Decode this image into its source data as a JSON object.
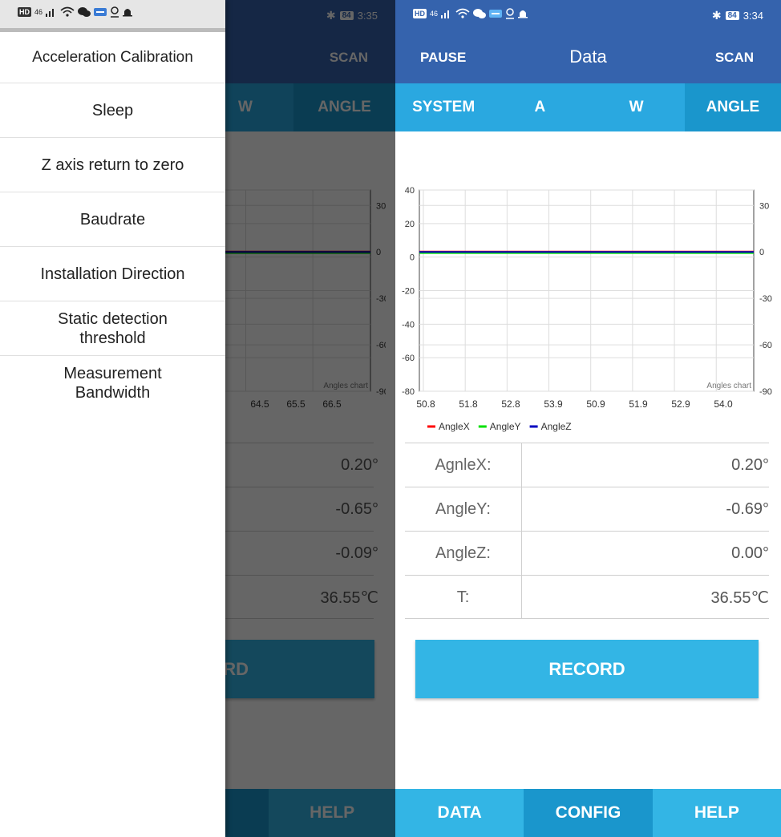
{
  "status_left": {
    "hd_badge": "HD",
    "network": "46",
    "time": "3:35",
    "battery": "84"
  },
  "status_right": {
    "hd_badge": "HD",
    "network": "46",
    "time": "3:34",
    "battery": "84"
  },
  "toolbar": {
    "pause_label": "PAUSE",
    "title": "Data",
    "scan_label": "SCAN"
  },
  "tabs": [
    {
      "label": "SYSTEM",
      "selected": false
    },
    {
      "label": "A",
      "selected": false
    },
    {
      "label": "W",
      "selected": false
    },
    {
      "label": "ANGLE",
      "selected": true
    }
  ],
  "chart_data": {
    "type": "line",
    "title": "Angles chart",
    "x_ticks_right": [
      "50.8",
      "51.8",
      "52.8",
      "53.9",
      "50.9",
      "51.9",
      "52.9",
      "54.0"
    ],
    "x_ticks_left": [
      "64.5",
      "65.5",
      "66.5"
    ],
    "left_axis_ticks": [
      40,
      20,
      0,
      -20,
      -40,
      -60,
      -80
    ],
    "right_axis_ticks": [
      30,
      0,
      -30,
      -60,
      -90
    ],
    "left_ylim": [
      -80,
      40
    ],
    "right_ylim": [
      -90,
      40
    ],
    "grid": true,
    "legend_placement": "bottom-left",
    "series": [
      {
        "name": "AngleX",
        "color": "#ff0000",
        "axis": "right",
        "values": [
          0.2,
          0.2,
          0.2,
          0.2,
          0.2,
          0.2,
          0.2,
          0.2
        ]
      },
      {
        "name": "AngleY",
        "color": "#00e000",
        "axis": "right",
        "values": [
          -0.69,
          -0.69,
          -0.69,
          -0.69,
          -0.69,
          -0.69,
          -0.69,
          -0.69
        ]
      },
      {
        "name": "AngleZ",
        "color": "#0000c0",
        "axis": "right",
        "values": [
          0.0,
          0.0,
          0.0,
          0.0,
          0.0,
          0.0,
          0.0,
          0.0
        ]
      }
    ]
  },
  "readings": [
    {
      "label": "AgnleX:",
      "value": "0.20°"
    },
    {
      "label": "AngleY:",
      "value": "-0.69°"
    },
    {
      "label": "AngleZ:",
      "value": "0.00°"
    },
    {
      "label": "T:",
      "value": "36.55℃"
    }
  ],
  "readings_left": [
    {
      "value": "0.20°"
    },
    {
      "value": "-0.65°"
    },
    {
      "value": "-0.09°"
    },
    {
      "value": "36.55℃"
    }
  ],
  "record_label": "RECORD",
  "record_label_left_visible": "RD",
  "bottom_nav": [
    {
      "label": "DATA",
      "selected": false
    },
    {
      "label": "CONFIG",
      "selected": true
    },
    {
      "label": "HELP",
      "selected": false
    }
  ],
  "bottom_nav_left_visible": "G",
  "drawer_menu": [
    "Acceleration Calibration",
    "Sleep",
    "Z axis return to zero",
    "Baudrate",
    "Installation Direction",
    "Static detection threshold",
    "Measurement Bandwidth"
  ],
  "colors": {
    "primary": "#3563ad",
    "tab_bar": "#2aa8e0",
    "tab_selected": "#1a96cc",
    "button": "#33b5e5"
  }
}
